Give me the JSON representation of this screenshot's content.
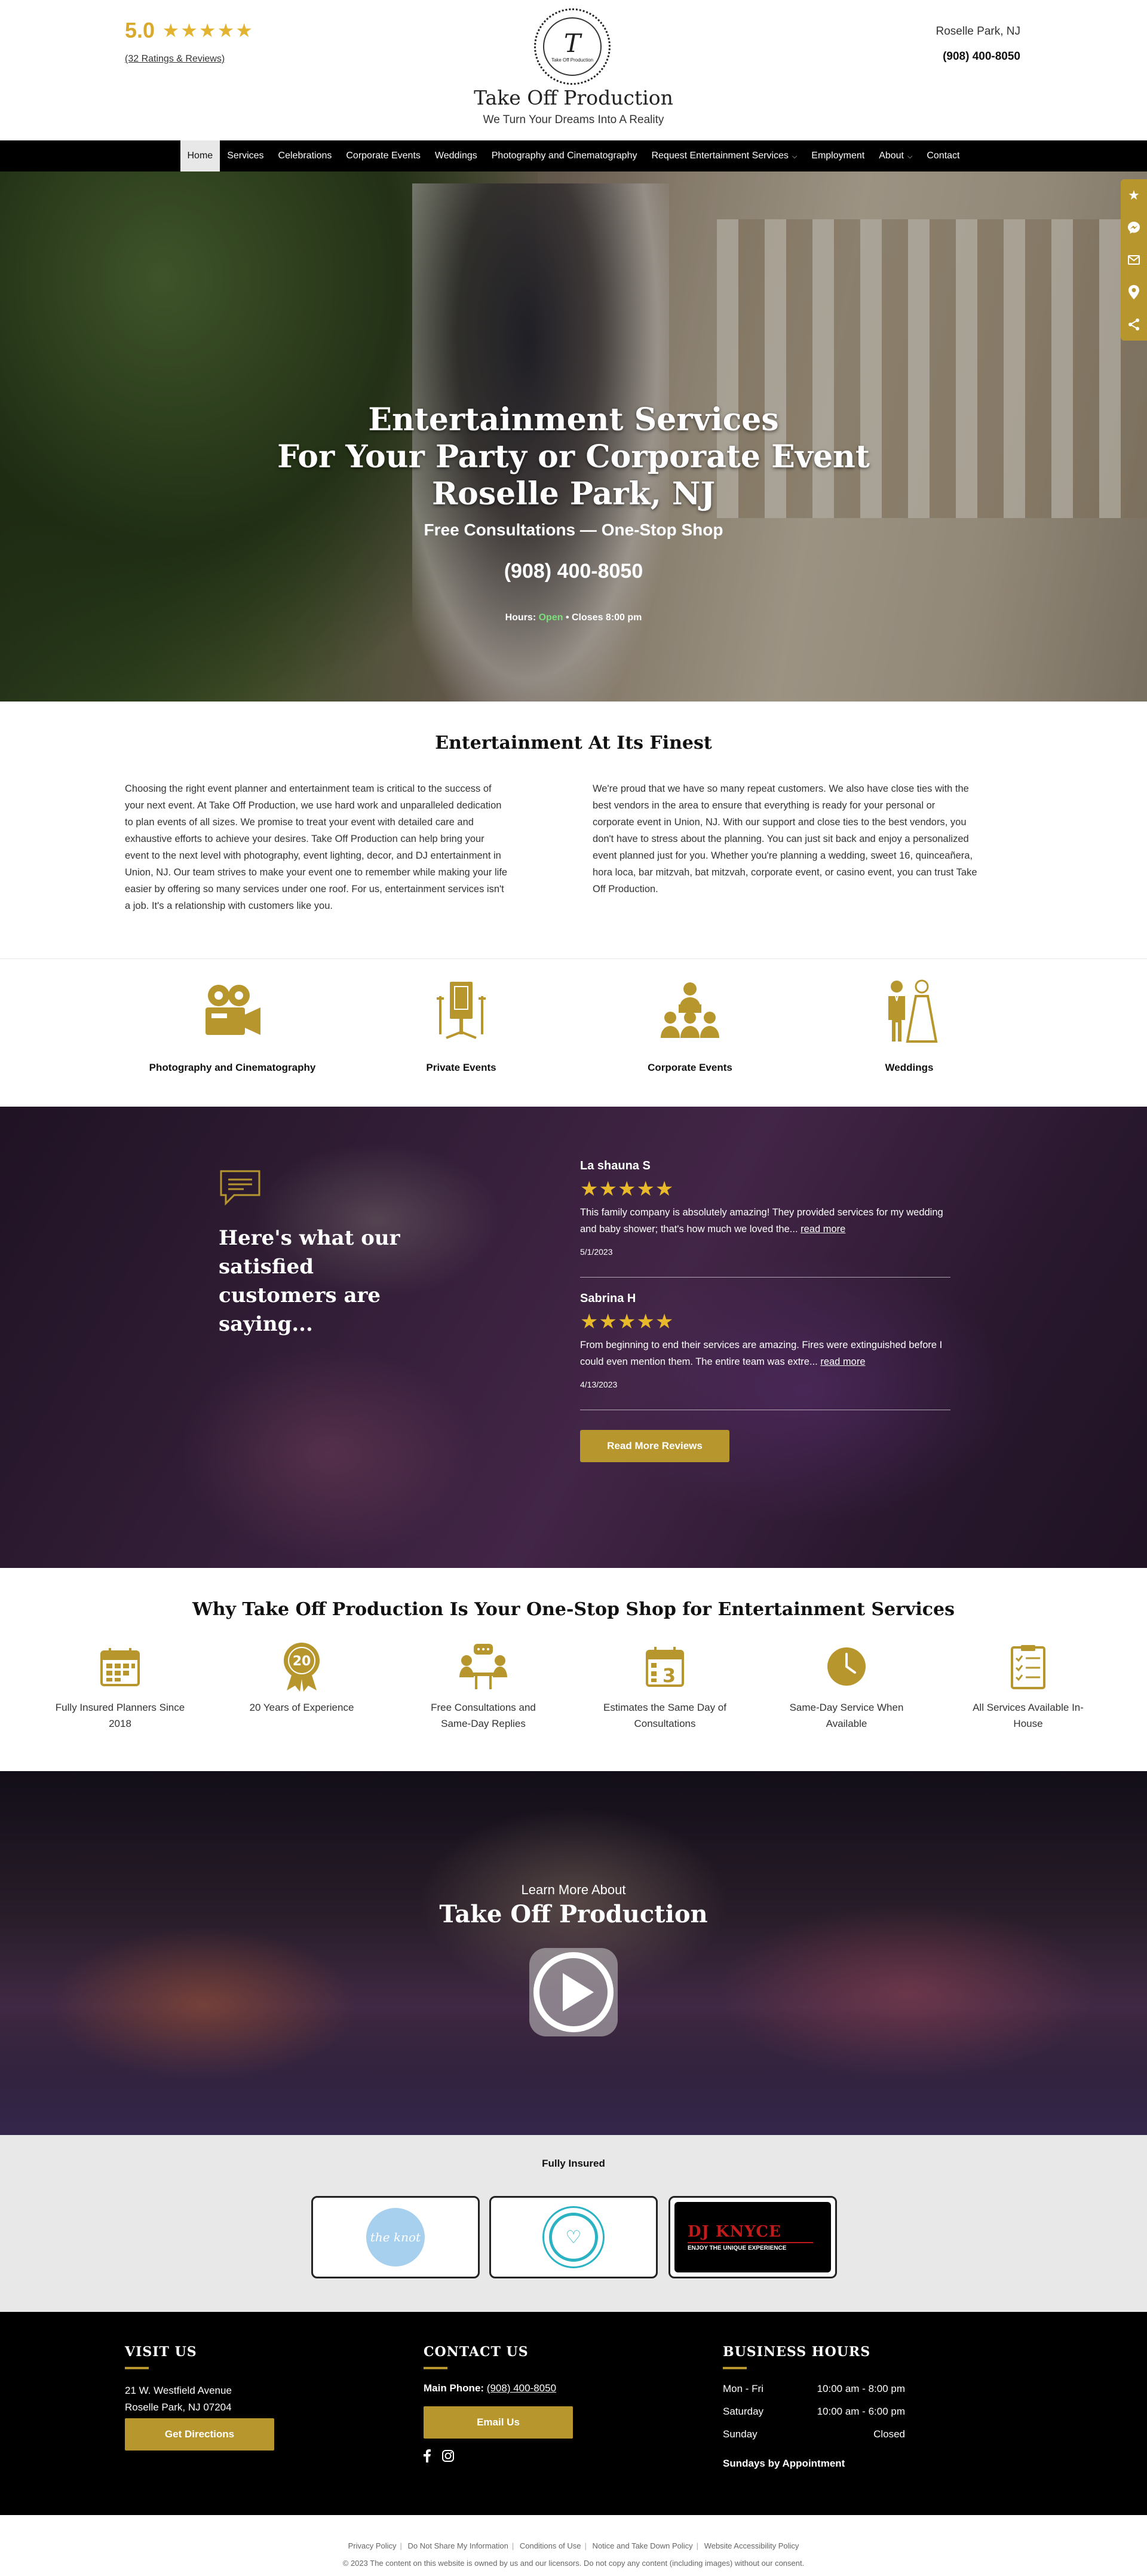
{
  "header": {
    "rating_score": "5.0",
    "rating_stars": "★★★★★",
    "rating_count": "(32 Ratings & Reviews)",
    "logo_mono": "T",
    "logo_small": "Take Off Production",
    "business_name": "Take Off Production",
    "tagline": "We Turn Your Dreams Into A Reality",
    "location": "Roselle Park, NJ",
    "phone": "(908) 400-8050"
  },
  "nav": {
    "items": [
      {
        "label": "Home"
      },
      {
        "label": "Services"
      },
      {
        "label": "Celebrations"
      },
      {
        "label": "Corporate Events"
      },
      {
        "label": "Weddings"
      },
      {
        "label": "Photography and Cinematography"
      },
      {
        "label": "Request Entertainment Services"
      },
      {
        "label": "Employment"
      },
      {
        "label": "About"
      },
      {
        "label": "Contact"
      }
    ]
  },
  "hero": {
    "headline_1": "Entertainment Services",
    "headline_2": "For Your Party or Corporate Event",
    "headline_3": "Roselle Park, NJ",
    "subhead": "Free Consultations  —  One-Stop Shop",
    "phone": "(908) 400-8050",
    "hours_label": "Hours:",
    "hours_status": "Open",
    "hours_close": "• Closes 8:00 pm"
  },
  "intro": {
    "title": "Entertainment At Its Finest",
    "col1": "Choosing the right event planner and entertainment team is critical to the success of your next event. At Take Off Production, we use hard work and unparalleled dedication to plan events of all sizes. We promise to treat your event with detailed care and exhaustive efforts to achieve your desires. Take Off Production can help bring your event to the next level with photography, event lighting, decor, and DJ entertainment in Union, NJ. Our team strives to make your event one to remember while making your life easier by offering so many services under one roof. For us, entertainment services isn't a job. It's a relationship with customers like you.",
    "col2": "We're proud that we have so many repeat customers. We also have close ties with the best vendors in the area to ensure that everything is ready for your personal or corporate event in Union, NJ. With our support and close ties to the best vendors, you don't have to stress about the planning. You can just sit back and enjoy a personalized event planned just for you. Whether you're planning a wedding, sweet 16, quinceañera, hora loca, bar mitzvah, bat mitzvah, corporate event, or casino event, you can trust Take Off Production."
  },
  "services": {
    "items": [
      {
        "label": "Photography and Cinematography",
        "icon": "video-camera-icon"
      },
      {
        "label": "Private Events",
        "icon": "photo-booth-icon"
      },
      {
        "label": "Corporate Events",
        "icon": "meeting-icon"
      },
      {
        "label": "Weddings",
        "icon": "bride-groom-icon"
      }
    ]
  },
  "reviews": {
    "heading": "Here's what our satisfied customers are saying...",
    "items": [
      {
        "name": "La shauna S",
        "stars": "★★★★★",
        "text": "This family company is absolutely amazing! They provided services for my wedding and baby shower; that's how much we loved the...",
        "more": "read more",
        "date": "5/1/2023"
      },
      {
        "name": "Sabrina H",
        "stars": "★★★★★",
        "text": "From beginning to end their services are amazing. Fires were extinguished before I could even mention them. The entire team was extre...",
        "more": "read more",
        "date": "4/13/2023"
      }
    ],
    "button": "Read More Reviews"
  },
  "why": {
    "title": "Why Take Off Production Is Your One-Stop Shop for Entertainment Services",
    "items": [
      {
        "label": "Fully Insured Planners Since 2018",
        "icon": "calendar-icon"
      },
      {
        "label": "20 Years of Experience",
        "icon": "medal-icon",
        "badge": "20"
      },
      {
        "label": "Free Consultations and Same-Day Replies",
        "icon": "consultation-icon"
      },
      {
        "label": "Estimates the Same Day of Consultations",
        "icon": "calendar-3-icon"
      },
      {
        "label": "Same-Day Service When Available",
        "icon": "clock-icon"
      },
      {
        "label": "All Services Available In-House",
        "icon": "checklist-icon"
      }
    ]
  },
  "video": {
    "learn": "Learn More About",
    "title": "Take Off Production"
  },
  "insured": {
    "title": "Fully Insured",
    "knot_label": "the knot",
    "dj_name": "DJ KNYCE",
    "dj_sub": "ENJOY THE UNIQUE EXPERIENCE"
  },
  "footer": {
    "visit_title": "VISIT US",
    "address_1": "21 W. Westfield Avenue",
    "address_2": "Roselle Park, NJ 07204",
    "directions_button": "Get Directions",
    "contact_title": "CONTACT US",
    "main_phone_label": "Main Phone:",
    "main_phone": "(908) 400-8050",
    "email_button": "Email Us",
    "hours_title": "BUSINESS HOURS",
    "hours": [
      {
        "day": "Mon - Fri",
        "time": "10:00 am - 8:00 pm"
      },
      {
        "day": "Saturday",
        "time": "10:00 am - 6:00 pm"
      },
      {
        "day": "Sunday",
        "time": "Closed"
      }
    ],
    "appointment": "Sundays by Appointment"
  },
  "legal": {
    "links": [
      "Privacy Policy",
      "Do Not Share My Information",
      "Conditions of Use",
      "Notice and Take Down Policy",
      "Website Accessibility Policy"
    ],
    "copyright": "© 2023 The content on this website is owned by us and our licensors. Do not copy any content (including images) without our consent."
  },
  "colors": {
    "accent": "#b8962e",
    "nav": "#000000",
    "stars": "#e3b431"
  }
}
